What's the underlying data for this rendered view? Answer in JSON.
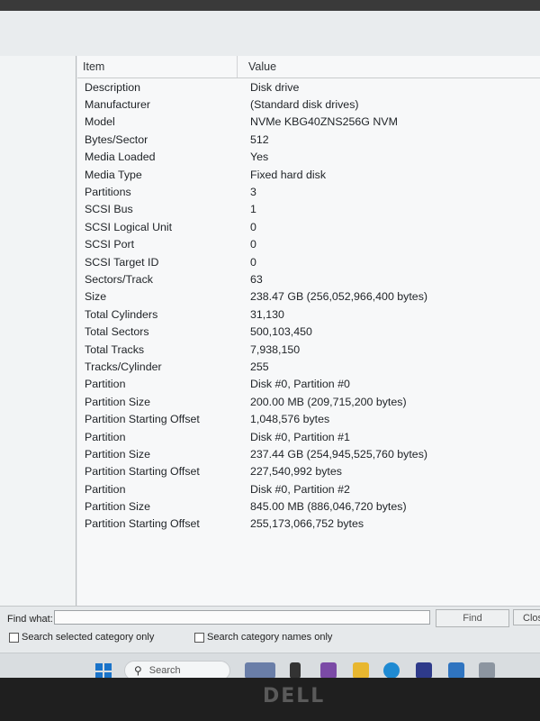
{
  "header": {
    "item": "Item",
    "value": "Value"
  },
  "rows": [
    {
      "k": "Description",
      "v": "Disk drive"
    },
    {
      "k": "Manufacturer",
      "v": "(Standard disk drives)"
    },
    {
      "k": "Model",
      "v": "NVMe KBG40ZNS256G NVM"
    },
    {
      "k": "Bytes/Sector",
      "v": "512"
    },
    {
      "k": "Media Loaded",
      "v": "Yes"
    },
    {
      "k": "Media Type",
      "v": "Fixed hard disk"
    },
    {
      "k": "Partitions",
      "v": "3"
    },
    {
      "k": "SCSI Bus",
      "v": "1"
    },
    {
      "k": "SCSI Logical Unit",
      "v": "0"
    },
    {
      "k": "SCSI Port",
      "v": "0"
    },
    {
      "k": "SCSI Target ID",
      "v": "0"
    },
    {
      "k": "Sectors/Track",
      "v": "63"
    },
    {
      "k": "Size",
      "v": "238.47 GB (256,052,966,400 bytes)"
    },
    {
      "k": "Total Cylinders",
      "v": "31,130"
    },
    {
      "k": "Total Sectors",
      "v": "500,103,450"
    },
    {
      "k": "Total Tracks",
      "v": "7,938,150"
    },
    {
      "k": "Tracks/Cylinder",
      "v": "255"
    },
    {
      "k": "Partition",
      "v": "Disk #0, Partition #0"
    },
    {
      "k": "Partition Size",
      "v": "200.00 MB (209,715,200 bytes)"
    },
    {
      "k": "Partition Starting Offset",
      "v": "1,048,576 bytes"
    },
    {
      "k": "Partition",
      "v": "Disk #0, Partition #1"
    },
    {
      "k": "Partition Size",
      "v": "237.44 GB (254,945,525,760 bytes)"
    },
    {
      "k": "Partition Starting Offset",
      "v": "227,540,992 bytes"
    },
    {
      "k": "Partition",
      "v": "Disk #0, Partition #2"
    },
    {
      "k": "Partition Size",
      "v": "845.00 MB (886,046,720 bytes)"
    },
    {
      "k": "Partition Starting Offset",
      "v": "255,173,066,752 bytes"
    }
  ],
  "find": {
    "label": "Find what:",
    "value": "",
    "find_button": "Find",
    "close_button": "Clos",
    "search_selected": "Search selected category only",
    "search_names": "Search category names only"
  },
  "taskbar": {
    "search_placeholder": "Search"
  },
  "brand": "DELL",
  "colors": {
    "accent": "#1a73c9",
    "taskbar": "#d9dde0"
  }
}
